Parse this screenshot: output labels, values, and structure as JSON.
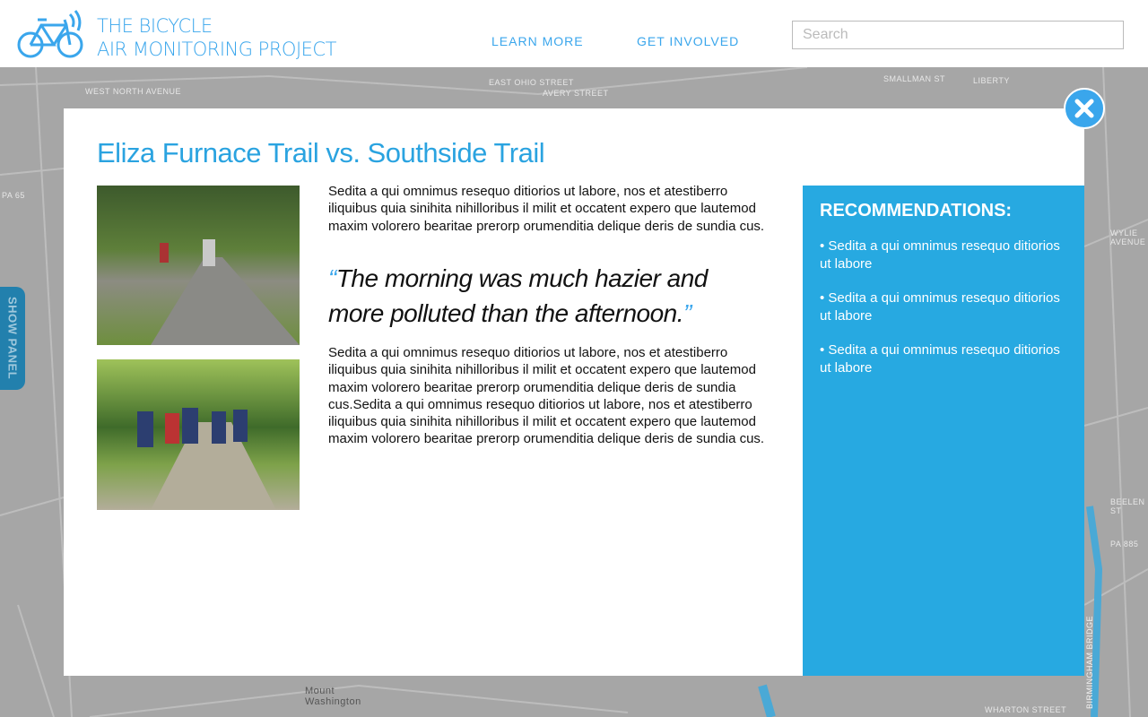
{
  "header": {
    "brand_line1": "THE BICYCLE",
    "brand_line2": "AIR MONITORING PROJECT",
    "nav": [
      {
        "label": "LEARN MORE"
      },
      {
        "label": "GET INVOLVED"
      }
    ],
    "search": {
      "placeholder": "Search",
      "value": ""
    }
  },
  "map": {
    "labels": [
      "WEST NORTH AVENUE",
      "EAST OHIO STREET",
      "AVERY STREET",
      "SMALLMAN ST",
      "LIBERTY",
      "PA 65",
      "PA 885",
      "Mount Washington",
      "WHARTON STREET",
      "BIRMINGHAM BRIDGE",
      "WYLIE AVENUE",
      "BEELEN ST"
    ]
  },
  "side_tab": {
    "label": "SHOW PANEL"
  },
  "modal": {
    "title": "Eliza Furnace Trail vs. Southside Trail",
    "paragraph1": "Sedita a qui omnimus resequo ditiorios ut labore, nos et atestiberro iliquibus quia sinihita nihilloribus il milit et occatent expero que lautemod maxim volorero bearitae prerorp orumenditia delique deris de sundia cus.",
    "quote": "The morning was much hazier and more polluted than the afternoon.",
    "quote_open": "“",
    "quote_close": "”",
    "paragraph2": "Sedita a qui omnimus resequo ditiorios ut labore, nos et atestiberro iliquibus quia sinihita nihilloribus il milit et occatent expero que lautemod maxim volorero bearitae prerorp orumenditia delique deris de sundia cus.Sedita a qui omnimus resequo ditiorios ut labore, nos et atestiberro iliquibus quia sinihita nihilloribus il milit et occatent expero que lautemod maxim volorero bearitae prerorp orumenditia delique deris de sundia cus.",
    "recommendations": {
      "title": "RECOMMENDATIONS:",
      "items": [
        "• Sedita a qui omnimus resequo ditiorios ut labore",
        "• Sedita a qui omnimus resequo ditiorios ut labore",
        "• Sedita a qui omnimus resequo ditiorios ut labore"
      ]
    }
  },
  "colors": {
    "accent": "#3aa6ec",
    "panel": "#27a9e1",
    "tab": "#2280ad"
  }
}
